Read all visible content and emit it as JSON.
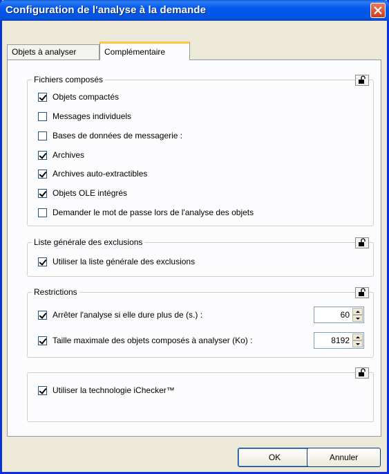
{
  "window": {
    "title": "Configuration de l'analyse à la demande"
  },
  "tabs": [
    {
      "label": "Objets à analyser",
      "active": false
    },
    {
      "label": "Complémentaire",
      "active": true
    }
  ],
  "groups": {
    "compound": {
      "title": "Fichiers composés",
      "items": [
        {
          "label": "Objets compactés",
          "checked": true
        },
        {
          "label": "Messages individuels",
          "checked": false
        },
        {
          "label": "Bases de données de messagerie :",
          "checked": false
        },
        {
          "label": "Archives",
          "checked": true
        },
        {
          "label": "Archives auto-extractibles",
          "checked": true
        },
        {
          "label": "Objets OLE intégrés",
          "checked": true
        },
        {
          "label": "Demander le mot de passe lors de l'analyse des objets",
          "checked": false
        }
      ]
    },
    "exclusions": {
      "title": "Liste générale des exclusions",
      "items": [
        {
          "label": "Utiliser la liste générale des exclusions",
          "checked": true
        }
      ]
    },
    "restrictions": {
      "title": "Restrictions",
      "items": [
        {
          "label": "Arrêter l'analyse si elle dure plus de (s.) :",
          "checked": true,
          "value": "60"
        },
        {
          "label": "Taille maximale des objets composés à analyser (Ko) :",
          "checked": true,
          "value": "8192"
        }
      ]
    },
    "ichecker": {
      "items": [
        {
          "label": "Utiliser la technologie iChecker™",
          "checked": true
        }
      ]
    }
  },
  "buttons": {
    "ok": "OK",
    "cancel": "Annuler"
  },
  "icons": {
    "lock": "padlock-open-icon",
    "close": "close-icon"
  }
}
